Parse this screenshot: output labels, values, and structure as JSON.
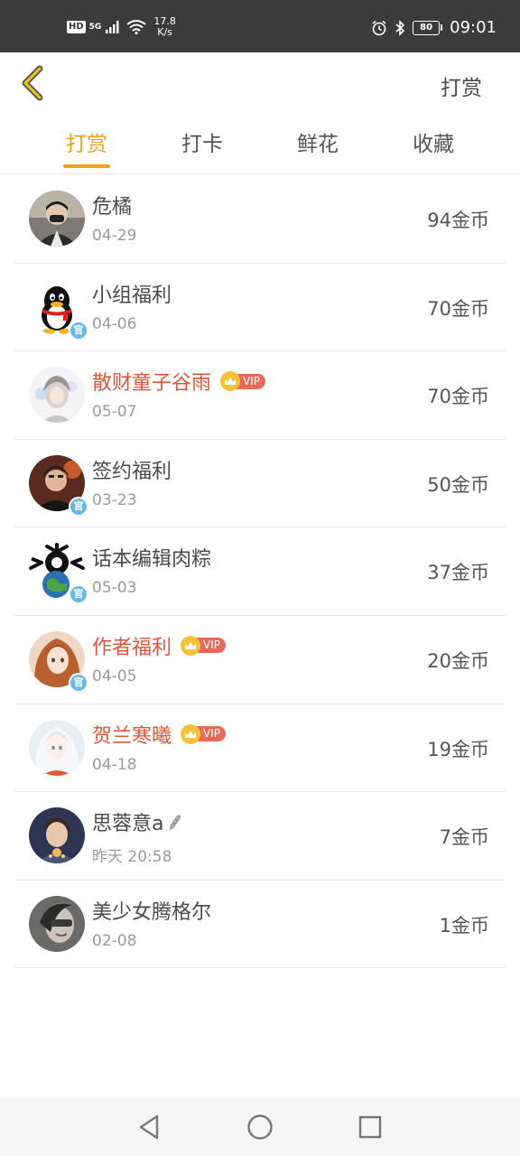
{
  "status_bar": {
    "hd": "HD",
    "network": "5G",
    "speed_value": "17.8",
    "speed_unit": "K/s",
    "battery": "80",
    "time": "09:01"
  },
  "header": {
    "back_icon": "chevron-left-icon",
    "action_label": "打赏"
  },
  "tabs": [
    {
      "label": "打赏",
      "active": true
    },
    {
      "label": "打卡",
      "active": false
    },
    {
      "label": "鲜花",
      "active": false
    },
    {
      "label": "收藏",
      "active": false
    }
  ],
  "vip_label": "VIP",
  "official_badge": "官",
  "rewards": [
    {
      "name": "危橘",
      "date": "04-29",
      "amount": "94金币",
      "vip": false,
      "official": false
    },
    {
      "name": "小组福利",
      "date": "04-06",
      "amount": "70金币",
      "vip": false,
      "official": true
    },
    {
      "name": "散财童子谷雨",
      "date": "05-07",
      "amount": "70金币",
      "vip": true,
      "official": false
    },
    {
      "name": "签约福利",
      "date": "03-23",
      "amount": "50金币",
      "vip": false,
      "official": true
    },
    {
      "name": "话本编辑肉粽",
      "date": "05-03",
      "amount": "37金币",
      "vip": false,
      "official": true
    },
    {
      "name": "作者福利",
      "date": "04-05",
      "amount": "20金币",
      "vip": true,
      "official": true
    },
    {
      "name": "贺兰寒曦",
      "date": "04-18",
      "amount": "19金币",
      "vip": true,
      "official": false
    },
    {
      "name": "思蓉意a",
      "date": "昨天 20:58",
      "amount": "7金币",
      "vip": false,
      "official": false,
      "wheat": true
    },
    {
      "name": "美少女腾格尔",
      "date": "02-08",
      "amount": "1金币",
      "vip": false,
      "official": false
    }
  ],
  "colors": {
    "accent": "#f0a31c",
    "vip_name": "#e0563a",
    "vip_tag": "#e86a56",
    "crown": "#f6c23b",
    "official_badge": "#6ab7ea"
  },
  "nav": [
    "back-triangle-icon",
    "home-circle-icon",
    "recents-square-icon"
  ]
}
